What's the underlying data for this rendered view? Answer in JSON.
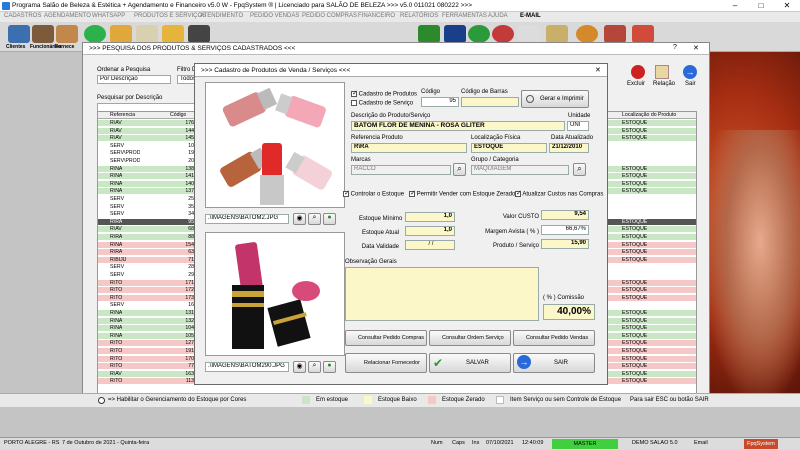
{
  "app_title": "Programa Salão de Beleza & Estética + Agendamento e Financeiro v5.0 W - FpqSystem ® | Licenciado para  SALÃO DE BELEZA >>> v5.0 011021 080222 >>>",
  "menu": [
    "CADASTROS",
    "AGENDAMENTO",
    "WHATSAPP",
    "PRODUTOS E SERVIÇOS",
    "ATENDIMENTO",
    "PEDIDO VENDAS",
    "PEDIDO COMPRAS",
    "FINANCEIRO",
    "RELATÓRIOS",
    "FERRAMENTAS",
    "AJUDA",
    "E-MAIL"
  ],
  "toolbar": {
    "clientes": "Clientes",
    "funcionarios": "Funcionários",
    "fornecedores": "Fornece"
  },
  "list_window": {
    "title": ">>>  PESQUISA DOS PRODUTOS & SERVIÇOS CADASTRADOS  <<<",
    "order_label": "Ordenar a Pesquisa",
    "order_value": "Por Descrição",
    "filter_label": "Filtro D",
    "filter_value": "Todos",
    "search_label": "Pesquisar por Descrição",
    "buttons": {
      "excluir": "Excluir",
      "relacao": "Relação",
      "sair": "Sair"
    },
    "col_ref": "Referencia",
    "col_code": "Código",
    "col_loc": "Localização do Produto",
    "rows": [
      {
        "ref": "R\\AV",
        "code": "176",
        "loc": "ESTOQUE",
        "color": "green"
      },
      {
        "ref": "R\\AV",
        "code": "144",
        "loc": "ESTOQUE",
        "color": "green"
      },
      {
        "ref": "R\\AV",
        "code": "145",
        "loc": "ESTOQUE",
        "color": "green"
      },
      {
        "ref": "SERV",
        "code": "10",
        "loc": "",
        "color": "white"
      },
      {
        "ref": "SERV\\PROD",
        "code": "19",
        "loc": "",
        "color": "white"
      },
      {
        "ref": "SERV\\PROD",
        "code": "20",
        "loc": "",
        "color": "white"
      },
      {
        "ref": "R\\NA",
        "code": "138",
        "loc": "ESTOQUE",
        "color": "green"
      },
      {
        "ref": "R\\NA",
        "code": "141",
        "loc": "ESTOQUE",
        "color": "green"
      },
      {
        "ref": "R\\NA",
        "code": "140",
        "loc": "ESTOQUE",
        "color": "green"
      },
      {
        "ref": "R\\NA",
        "code": "137",
        "loc": "ESTOQUE",
        "color": "green"
      },
      {
        "ref": "SERV",
        "code": "25",
        "loc": "",
        "color": "white"
      },
      {
        "ref": "SERV",
        "code": "35",
        "loc": "",
        "color": "white"
      },
      {
        "ref": "SERV",
        "code": "34",
        "loc": "",
        "color": "white"
      },
      {
        "ref": "R\\RA",
        "code": "95",
        "loc": "ESTOQUE",
        "color": "dark"
      },
      {
        "ref": "R\\AV",
        "code": "68",
        "loc": "ESTOQUE",
        "color": "green"
      },
      {
        "ref": "R\\RA",
        "code": "88",
        "loc": "ESTOQUE",
        "color": "green"
      },
      {
        "ref": "R\\NA",
        "code": "154",
        "loc": "ESTOQUE",
        "color": "red"
      },
      {
        "ref": "R\\RA",
        "code": "63",
        "loc": "ESTOQUE",
        "color": "red"
      },
      {
        "ref": "R\\BIJU",
        "code": "71",
        "loc": "ESTOQUE",
        "color": "red"
      },
      {
        "ref": "SERV",
        "code": "28",
        "loc": "",
        "color": "white"
      },
      {
        "ref": "SERV",
        "code": "29",
        "loc": "",
        "color": "white"
      },
      {
        "ref": "R\\TO",
        "code": "171",
        "loc": "ESTOQUE",
        "color": "red"
      },
      {
        "ref": "R\\TO",
        "code": "172",
        "loc": "ESTOQUE",
        "color": "red"
      },
      {
        "ref": "R\\TO",
        "code": "173",
        "loc": "ESTOQUE",
        "color": "red"
      },
      {
        "ref": "SERV",
        "code": "16",
        "loc": "",
        "color": "white"
      },
      {
        "ref": "R\\NA",
        "code": "131",
        "loc": "ESTOQUE",
        "color": "green"
      },
      {
        "ref": "R\\NA",
        "code": "132",
        "loc": "ESTOQUE",
        "color": "green"
      },
      {
        "ref": "R\\NA",
        "code": "104",
        "loc": "ESTOQUE",
        "color": "green"
      },
      {
        "ref": "R\\NA",
        "code": "105",
        "loc": "ESTOQUE",
        "color": "green"
      },
      {
        "ref": "R\\TO",
        "code": "127",
        "loc": "ESTOQUE",
        "color": "red"
      },
      {
        "ref": "R\\TO",
        "code": "191",
        "loc": "ESTOQUE",
        "color": "red"
      },
      {
        "ref": "R\\TO",
        "code": "170",
        "loc": "ESTOQUE",
        "color": "red"
      },
      {
        "ref": "R\\TO",
        "code": "77",
        "loc": "ESTOQUE",
        "color": "red"
      },
      {
        "ref": "R\\AV",
        "code": "163",
        "loc": "ESTOQUE",
        "color": "green"
      },
      {
        "ref": "R\\TO",
        "code": "113",
        "loc": "ESTOQUE",
        "color": "red"
      }
    ]
  },
  "dialog": {
    "title": ">>>  Cadastro de Produtos de Venda / Serviços  <<<",
    "chk_produtos": "Cadastro de Produtos",
    "chk_servico": "Cadastro de Serviço",
    "codigo_label": "Código",
    "codigo_value": "95",
    "barras_label": "Código de Barras",
    "barras_value": "",
    "gerar_btn": "Gerar e Imprimir",
    "desc_label": "Descrição do Produto/Serviço",
    "desc_value": "BATOM FLOR DE MENINA - ROSA GLITER",
    "unidade_label": "Unidade",
    "unidade_value": "UNI",
    "ref_label": "Referencia Produto",
    "ref_value": "R\\RA",
    "loc_label": "Localização Física",
    "loc_value": "ESTOQUE",
    "data_label": "Data Atualizado",
    "data_value": "21/12/2010",
    "marcas_label": "Marcas",
    "marcas_value": "RACCO",
    "grupo_label": "Grupo / Categoria",
    "grupo_value": "MAQUIAGEM",
    "img1_path": ".\\IMAGENS\\BATOM2.JPG",
    "img2_path": ".\\IMAGENS\\BATOM290.JPG",
    "chk_controlar": "Controlar o Estoque",
    "chk_permitir": "Permitir Vender com Estoque Zerado",
    "chk_atualizar": "Atualizar Custos nas Compras",
    "estoque_min_label": "Estoque Mínimo",
    "estoque_min_value": "1,0",
    "estoque_atual_label": "Estoque Atual",
    "estoque_atual_value": "1,0",
    "validade_label": "Data Validade",
    "validade_value": "/  /",
    "custo_label": "Valor CUSTO",
    "custo_value": "9,54",
    "margem_label": "Margem Avista ( % )",
    "margem_value": "66,67%",
    "produto_label": "Produto / Serviço",
    "produto_value": "15,90",
    "obs_label": "Observação Gerais",
    "comissao_label": "( % ) Comissão",
    "comissao_value": "40,00%",
    "btn_pedido_compras": "Consultar Pedido Compras",
    "btn_ordem_servico": "Consultar Ordem Serviço",
    "btn_pedido_vendas": "Consultar Pedido Vendas",
    "btn_fornecedor": "Relacionar Fornecedor",
    "btn_salvar": "SALVAR",
    "btn_sair": "SAIR"
  },
  "legend": {
    "habilitar": "=> Habilitar o Gerenciamento do Estoque por Cores",
    "em_estoque": "Em estoque",
    "estoque_baixo": "Estoque Baixo",
    "estoque_zerado": "Estoque Zerado",
    "sem_controle": "Item Serviço ou sem Controle de Estoque",
    "sair_hint": "Para sair ESC ou botão SAIR"
  },
  "status": {
    "city": "PORTO ALEGRE - RS",
    "date": "7 de Outubro de 2021 - Quinta-feira",
    "num": "Num",
    "caps": "Caps",
    "ins": "Ins",
    "date2": "07/10/2021",
    "time": "12:40:09",
    "master": "MASTER",
    "demo": "DEMO SALAO 5.0",
    "email": "Email",
    "brand": "FpqSystem"
  },
  "colors": {
    "green": "#c9e7c5",
    "red": "#f6c7c7",
    "yellow": "#fbf7c8"
  }
}
